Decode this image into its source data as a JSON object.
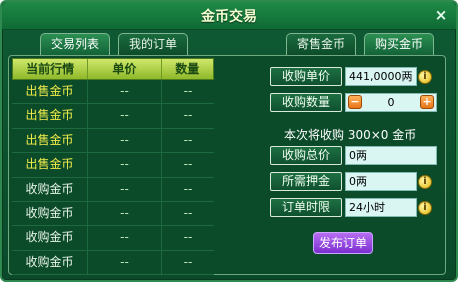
{
  "window": {
    "title": "金币交易",
    "close": "×"
  },
  "tabs": {
    "left": [
      {
        "label": "交易列表"
      },
      {
        "label": "我的订单"
      }
    ],
    "right": [
      {
        "label": "寄售金币"
      },
      {
        "label": "购买金币"
      }
    ]
  },
  "table": {
    "headers": [
      "当前行情",
      "单价",
      "数量"
    ],
    "rows": [
      {
        "type": "出售金币",
        "price": "--",
        "qty": "--"
      },
      {
        "type": "出售金币",
        "price": "--",
        "qty": "--"
      },
      {
        "type": "出售金币",
        "price": "--",
        "qty": "--"
      },
      {
        "type": "出售金币",
        "price": "--",
        "qty": "--"
      },
      {
        "type": "收购金币",
        "price": "--",
        "qty": "--"
      },
      {
        "type": "收购金币",
        "price": "--",
        "qty": "--"
      },
      {
        "type": "收购金币",
        "price": "--",
        "qty": "--"
      },
      {
        "type": "收购金币",
        "price": "--",
        "qty": "--"
      }
    ]
  },
  "form": {
    "unit_price": {
      "label": "收购单价",
      "value": "441,0000两"
    },
    "quantity": {
      "label": "收购数量",
      "value": "0",
      "minus": "−",
      "plus": "+"
    },
    "summary": "本次将收购  300×0  金币",
    "total": {
      "label": "收购总价",
      "value": "0两"
    },
    "deposit": {
      "label": "所需押金",
      "value": "0两"
    },
    "time_limit": {
      "label": "订单时限",
      "value": "24小时"
    },
    "info_glyph": "i",
    "publish_label": "发布订单"
  }
}
